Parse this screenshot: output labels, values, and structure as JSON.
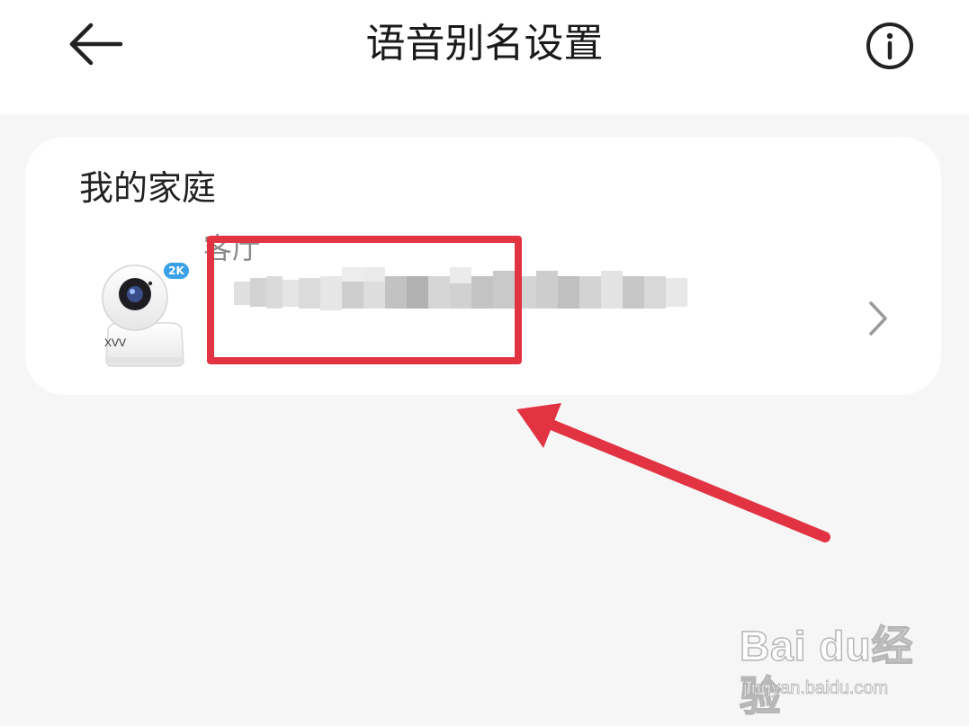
{
  "header": {
    "title": "语音别名设置",
    "back_icon": "arrow-left-icon",
    "info_icon": "info-circle-icon"
  },
  "home": {
    "section_title": "我的家庭",
    "device": {
      "badge": "2K",
      "image_brand": "XVV",
      "room": "客厅",
      "name_obscured": true,
      "chevron_icon": "chevron-right-icon"
    }
  },
  "annotation": {
    "highlight_color": "#e23342",
    "arrow_color": "#e23342"
  },
  "watermark": {
    "brand": "Bai du经验",
    "url": "jingyan.baidu.com"
  }
}
